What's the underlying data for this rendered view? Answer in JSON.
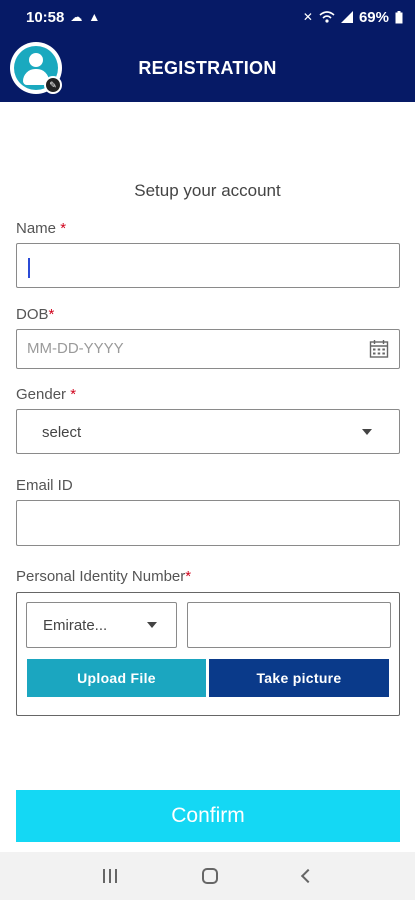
{
  "status_bar": {
    "time": "10:58",
    "left_icons": [
      "cloud-icon",
      "warning-icon"
    ],
    "right_icons": [
      "mute-icon",
      "wifi-icon",
      "signal-icon",
      "battery-icon"
    ],
    "battery": "69%"
  },
  "header": {
    "title": "REGISTRATION",
    "avatar_icon": "user-avatar-icon",
    "edit_icon": "pencil-icon"
  },
  "form": {
    "subtitle": "Setup your account",
    "required_mark": "*",
    "name": {
      "label": "Name",
      "value": ""
    },
    "dob": {
      "label": "DOB",
      "placeholder": "MM-DD-YYYY",
      "icon": "calendar-icon"
    },
    "gender": {
      "label": "Gender",
      "selected": "select"
    },
    "email": {
      "label": "Email ID",
      "value": ""
    },
    "pin": {
      "label": "Personal Identity Number",
      "type_selected": "Emirate...",
      "number_value": "",
      "upload_label": "Upload File",
      "picture_label": "Take picture",
      "upload_color": "#1ba6c0",
      "picture_color": "#0a3a8a"
    },
    "confirm_label": "Confirm",
    "confirm_color": "#14d8f4"
  },
  "nav": {
    "icons": [
      "recents-icon",
      "home-icon",
      "back-icon"
    ]
  }
}
